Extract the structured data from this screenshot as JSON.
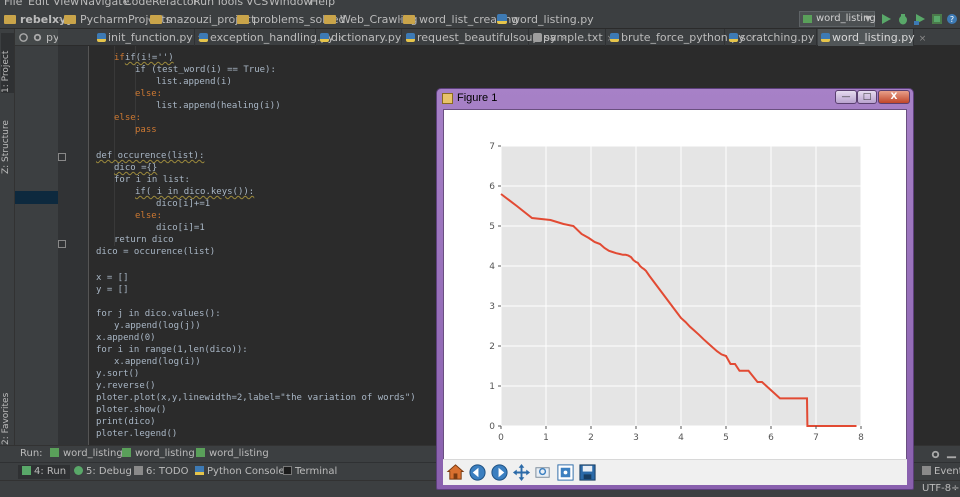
{
  "menubar": [
    "File",
    "Edit",
    "View",
    "Navigate",
    "Code",
    "Refactor",
    "Run",
    "Tools",
    "VCS",
    "Window",
    "Help"
  ],
  "navbar": {
    "crumbs": [
      "rebelxyy",
      "PycharmProjects",
      "mazouzi_project",
      "problems_solved",
      "Web_Crawling",
      "word_list_creating",
      "word_listing.py"
    ],
    "run_config": "word_listing"
  },
  "sidebar": {
    "project_tab": "1: Project",
    "structure_tab": "Z: Structure",
    "favorites_tab": "2: Favorites",
    "project_header": "py"
  },
  "tabs": [
    {
      "label": "init_function.py"
    },
    {
      "label": "exception_handling.py"
    },
    {
      "label": "dictionary.py"
    },
    {
      "label": "request_beautifulsoup.py"
    },
    {
      "label": "sample.txt"
    },
    {
      "label": "brute_force_python.py"
    },
    {
      "label": "scratching.py"
    },
    {
      "label": "word_listing.py"
    }
  ],
  "code": {
    "l1": "if(i!='')",
    "l2": "if (test_word(i) == True):",
    "l3": "list.append(i)",
    "l4": "else:",
    "l5": "list.append(healing(i))",
    "l6": "else:",
    "l7": "pass",
    "l8": "def occurence(list):",
    "l9": "dico ={}",
    "l10": "for i in list:",
    "l11": "if( i in dico.keys()):",
    "l12": "dico[i]+=1",
    "l13": "else:",
    "l14": "dico[i]=1",
    "l15": "return dico",
    "l16": "dico = occurence(list)",
    "l17": "x = []",
    "l18": "y = []",
    "l19": "for j in dico.values():",
    "l20": "y.append(log(j))",
    "l21": "x.append(0)",
    "l22": "for i in range(1,len(dico)):",
    "l23": "x.append(log(i))",
    "l24": "y.sort()",
    "l25": "y.reverse()",
    "l26": "ploter.plot(x,y,linewidth=2,label=\"the variation of words\")",
    "l27": "ploter.show()",
    "l28": "print(dico)",
    "l29": "ploter.legend()"
  },
  "runbar": {
    "label": "Run:",
    "tabs": [
      "word_listing",
      "word_listing",
      "word_listing"
    ]
  },
  "bottom_tools": [
    "4: Run",
    "5: Debug",
    "6: TODO",
    "Python Console",
    "Terminal"
  ],
  "status": {
    "event_log": "Event L",
    "encoding": "UTF-8",
    "encoding_suffix": "÷"
  },
  "figure": {
    "title": "Figure 1",
    "buttons": {
      "minimize": "—",
      "maximize": "□",
      "close": "X"
    },
    "toolbar": [
      "home-icon",
      "back-icon",
      "forward-icon",
      "pan-icon",
      "zoom-icon",
      "configure-subplots-icon",
      "save-icon"
    ]
  },
  "colors": {
    "ide_bg": "#2b2b2b",
    "panel_bg": "#3c3f41",
    "keyword": "#cc7832",
    "string": "#6a8759",
    "line_color": "#e24a33",
    "plot_bg": "#e5e5e5",
    "window_frame": "#a781c7"
  },
  "chart_data": {
    "type": "line",
    "title": "",
    "xlabel": "",
    "ylabel": "",
    "xlim": [
      0,
      8
    ],
    "ylim": [
      0,
      7
    ],
    "xticks": [
      "0",
      "1",
      "2",
      "3",
      "4",
      "5",
      "6",
      "7",
      "8"
    ],
    "yticks": [
      "0",
      "1",
      "2",
      "3",
      "4",
      "5",
      "6",
      "7"
    ],
    "grid": true,
    "legend": "none",
    "series": [
      {
        "x": [
          0,
          0.35,
          0.69,
          1.1,
          1.39,
          1.61,
          1.79,
          1.95,
          2.08,
          2.2,
          2.3,
          2.4,
          2.48,
          2.56,
          2.64,
          2.71,
          2.77,
          2.83,
          2.89,
          2.94,
          3.0,
          3.04,
          3.09,
          3.14,
          3.18,
          3.22,
          3.3,
          3.4,
          3.5,
          3.6,
          3.7,
          3.8,
          3.9,
          4.0,
          4.1,
          4.2,
          4.3,
          4.4,
          4.5,
          4.6,
          4.7,
          4.8,
          4.9,
          5.0,
          5.1,
          5.2,
          5.3,
          5.5,
          5.7,
          5.8,
          6.2,
          6.4,
          6.8,
          6.81,
          7.9
        ],
        "y": [
          5.8,
          5.5,
          5.2,
          5.15,
          5.05,
          5.0,
          4.8,
          4.7,
          4.6,
          4.55,
          4.45,
          4.38,
          4.35,
          4.32,
          4.3,
          4.28,
          4.28,
          4.26,
          4.22,
          4.15,
          4.1,
          4.08,
          4.0,
          3.95,
          3.92,
          3.88,
          3.75,
          3.6,
          3.45,
          3.3,
          3.15,
          3.0,
          2.85,
          2.7,
          2.6,
          2.48,
          2.38,
          2.28,
          2.17,
          2.07,
          1.97,
          1.87,
          1.79,
          1.75,
          1.55,
          1.55,
          1.38,
          1.38,
          1.1,
          1.1,
          0.69,
          0.69,
          0.69,
          0.0,
          0.0
        ]
      }
    ]
  }
}
